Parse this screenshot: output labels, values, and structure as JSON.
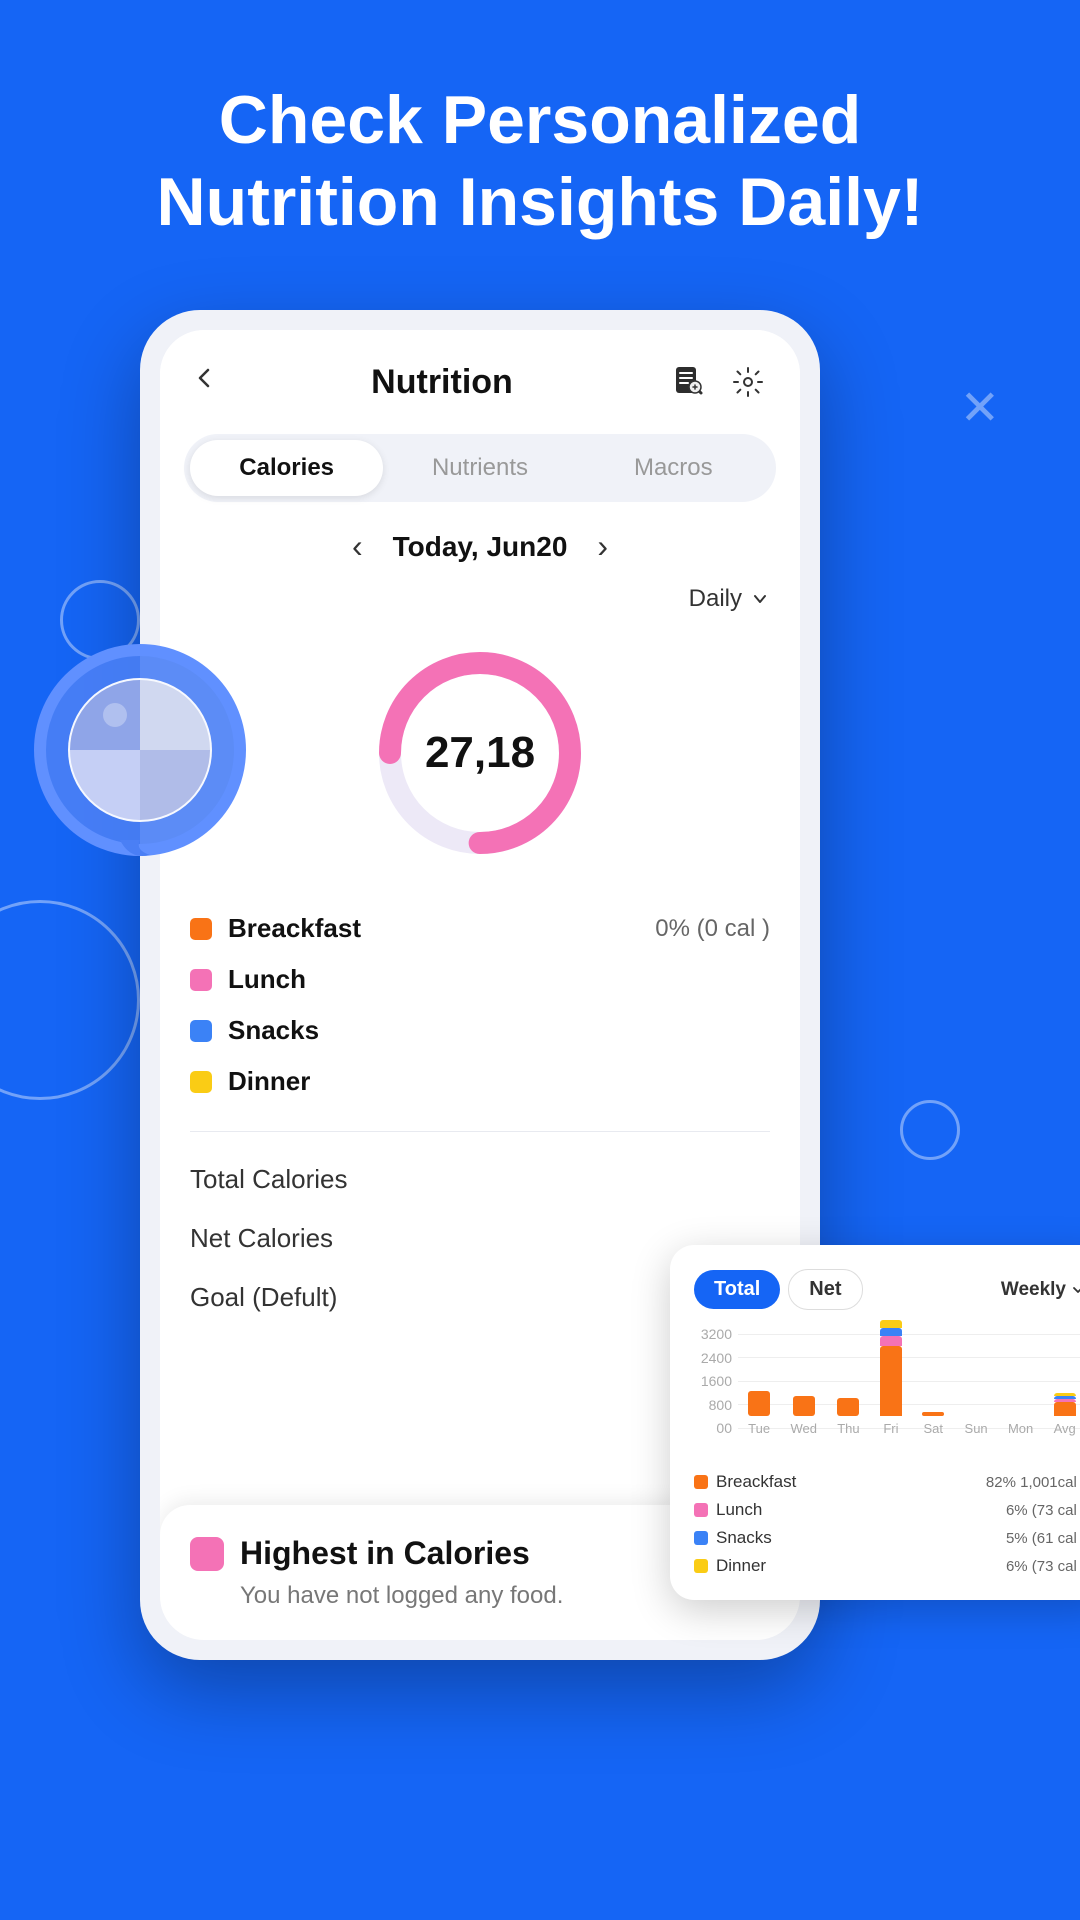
{
  "header": {
    "line1": "Check Personalized",
    "line2": "Nutrition Insights Daily!"
  },
  "phone": {
    "nav": {
      "title": "Nutrition",
      "back_icon": "←",
      "file_icon": "📄",
      "settings_icon": "⚙"
    },
    "tabs": [
      {
        "label": "Calories",
        "active": true
      },
      {
        "label": "Nutrients",
        "active": false
      },
      {
        "label": "Macros",
        "active": false
      }
    ],
    "date": {
      "label": "Today, Jun20",
      "prev_icon": "‹",
      "next_icon": "›"
    },
    "period": {
      "label": "Daily",
      "dropdown_icon": "∨"
    },
    "donut": {
      "value": "27,18",
      "progress_pct": 75,
      "color_track": "#e8eaf0",
      "color_fill": "#f472b6"
    },
    "legend": [
      {
        "name": "Breackfast",
        "color": "#f97316",
        "value": "0% (0 cal )"
      },
      {
        "name": "Lunch",
        "color": "#f472b6",
        "value": ""
      },
      {
        "name": "Snacks",
        "color": "#3b82f6",
        "value": ""
      },
      {
        "name": "Dinner",
        "color": "#facc15",
        "value": ""
      }
    ],
    "stats": [
      "Total Calories",
      "Net Calories",
      "Goal (Defult)"
    ],
    "bottom_card": {
      "icon_color": "#f472b6",
      "title": "Highest in Calories",
      "description": "You have not logged any food."
    }
  },
  "weekly_chart": {
    "tabs": [
      {
        "label": "Total",
        "active": true
      },
      {
        "label": "Net",
        "active": false
      }
    ],
    "period_label": "Weekly",
    "grid_labels": [
      "3200",
      "2400",
      "1600",
      "800",
      "00"
    ],
    "day_labels": [
      "Tue",
      "Wed",
      "Thu",
      "Fri",
      "Sat",
      "Sun",
      "Mon",
      "Avg"
    ],
    "bars": [
      {
        "day": "Tue",
        "breakfast": 25,
        "lunch": 0,
        "snacks": 0,
        "dinner": 0
      },
      {
        "day": "Wed",
        "breakfast": 20,
        "lunch": 0,
        "snacks": 0,
        "dinner": 0
      },
      {
        "day": "Thu",
        "breakfast": 18,
        "lunch": 0,
        "snacks": 0,
        "dinner": 0
      },
      {
        "day": "Fri",
        "breakfast": 70,
        "lunch": 10,
        "snacks": 8,
        "dinner": 8
      },
      {
        "day": "Sat",
        "breakfast": 4,
        "lunch": 0,
        "snacks": 0,
        "dinner": 0
      },
      {
        "day": "Sun",
        "breakfast": 0,
        "lunch": 0,
        "snacks": 0,
        "dinner": 0
      },
      {
        "day": "Mon",
        "breakfast": 0,
        "lunch": 0,
        "snacks": 0,
        "dinner": 0
      },
      {
        "day": "Avg",
        "breakfast": 14,
        "lunch": 3,
        "snacks": 3,
        "dinner": 3
      }
    ],
    "legend": [
      {
        "name": "Breackfast",
        "color": "#f97316",
        "value": "82% 1,001cal )"
      },
      {
        "name": "Lunch",
        "color": "#f472b6",
        "value": "6% (73 cal )"
      },
      {
        "name": "Snacks",
        "color": "#3b82f6",
        "value": "5% (61 cal )"
      },
      {
        "name": "Dinner",
        "color": "#facc15",
        "value": "6% (73 cal )"
      }
    ]
  }
}
